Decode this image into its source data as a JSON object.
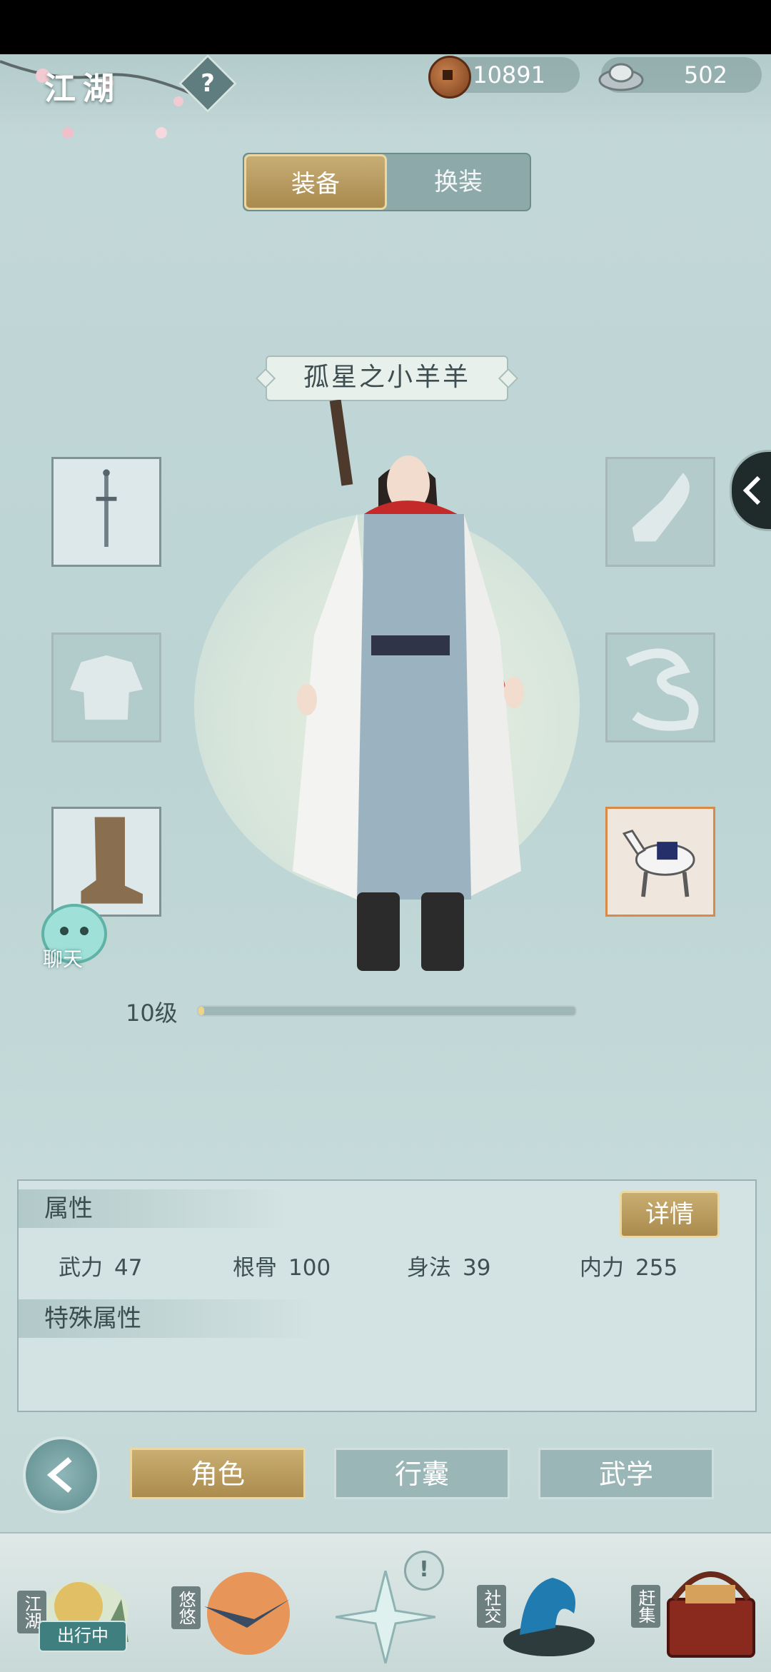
{
  "header": {
    "title": "江湖",
    "help_icon": "help-icon",
    "copper": {
      "value": "10891",
      "icon": "copper-coin-icon"
    },
    "silver": {
      "value": "502",
      "icon": "silver-ingot-icon"
    }
  },
  "tabs": [
    {
      "label": "装备",
      "active": true
    },
    {
      "label": "换装",
      "active": false
    }
  ],
  "character": {
    "name": "孤星之小羊羊",
    "level_label": "10级",
    "level_progress": 0.01
  },
  "slots": [
    {
      "name": "weapon-slot",
      "icon": "sword-icon",
      "filled": true
    },
    {
      "name": "clothes-slot",
      "icon": "robe-icon",
      "filled": false
    },
    {
      "name": "boots-slot",
      "icon": "boot-icon",
      "filled": true
    },
    {
      "name": "accessory-slot",
      "icon": "wrap-icon",
      "filled": false
    },
    {
      "name": "cloud-slot",
      "icon": "cloud-icon",
      "filled": false
    },
    {
      "name": "mount-slot",
      "icon": "horse-icon",
      "filled": true
    }
  ],
  "chat": {
    "label": "聊天"
  },
  "attributes": {
    "heading": "属性",
    "detail_button": "详情",
    "stats": [
      {
        "key": "武力",
        "value": "47"
      },
      {
        "key": "根骨",
        "value": "100"
      },
      {
        "key": "身法",
        "value": "39"
      },
      {
        "key": "内力",
        "value": "255"
      }
    ],
    "special_heading": "特殊属性"
  },
  "nav": {
    "buttons": [
      {
        "label": "角色",
        "active": true
      },
      {
        "label": "行囊",
        "active": false
      },
      {
        "label": "武学",
        "active": false
      }
    ]
  },
  "bottom": {
    "items": [
      {
        "label": "江湖",
        "badge": "出行中"
      },
      {
        "label": "悠悠"
      },
      {
        "label": ""
      },
      {
        "label": "社交"
      },
      {
        "label": "赶集"
      }
    ],
    "alert": "!"
  },
  "colors": {
    "gold": "#c9ad71",
    "teal": "#8ea9aa",
    "mount_border": "#d98a48"
  }
}
